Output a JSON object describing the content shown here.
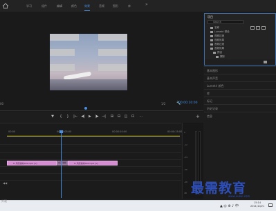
{
  "workspace_tabs": [
    "学习",
    "组件",
    "编辑",
    "颜色",
    "效果",
    "音频",
    "图形",
    "库"
  ],
  "workspace_active_index": 4,
  "workspace_more": "»",
  "monitor": {
    "left_readout": "00",
    "fit_label": "1/2",
    "timecode": "00:00:10:00"
  },
  "transport": [
    "▼",
    "{",
    "}",
    "|←",
    "◀|",
    "▶",
    "|▶",
    "→|",
    "⊞",
    "⊟",
    "◫",
    "⊡",
    "⋯"
  ],
  "project": {
    "title": "项目",
    "search_placeholder": "Search",
    "bins": [
      {
        "label": "名称",
        "indent": 0
      },
      {
        "label": "Lumetri 预设",
        "indent": 0
      },
      {
        "label": "视频过渡",
        "indent": 0
      },
      {
        "label": "视频效果",
        "indent": 0
      },
      {
        "label": "音频过渡",
        "indent": 0
      },
      {
        "label": "音频效果",
        "indent": 0
      },
      {
        "label": "预设",
        "indent": 0
      },
      {
        "label": "擦除",
        "indent": 1
      },
      {
        "label": "交叉溶解",
        "indent": 2,
        "selected": true
      }
    ]
  },
  "side_panels": [
    "基本图形",
    "基本声音",
    "Lumetri 颜色",
    "库",
    "标记",
    "历史记录",
    "信息"
  ],
  "timeline": {
    "ruler_labels": [
      "00:00",
      "00:00:05:00",
      "00:00:10:00",
      "00:00:15:00"
    ],
    "clips": [
      {
        "label": "fx 风景素材001.mp4 [V]",
        "kind": "pink"
      },
      {
        "label": "交叉溶解",
        "kind": "mid"
      },
      {
        "label": "fx 风景素材002.mp4 [V]",
        "kind": "pink"
      }
    ],
    "track_icon": "◀◀"
  },
  "meter_scale": [
    "0",
    "-12",
    "-24",
    "-36",
    "-48",
    "dB"
  ],
  "watermark": {
    "title": "最需教育",
    "subtitle": "www.xuexi.com"
  },
  "status_text": "外观",
  "taskbar": {
    "tray_icons": "▲ ◎ ⊕ ♪ 中",
    "time": "15:14",
    "date": "2021/10/21"
  },
  "colors": {
    "accent": "#4a90e2",
    "clip_pink": "#d48dd1",
    "timeline_yellow": "#c9c13a",
    "watermark_blue": "#2f4fb8"
  }
}
